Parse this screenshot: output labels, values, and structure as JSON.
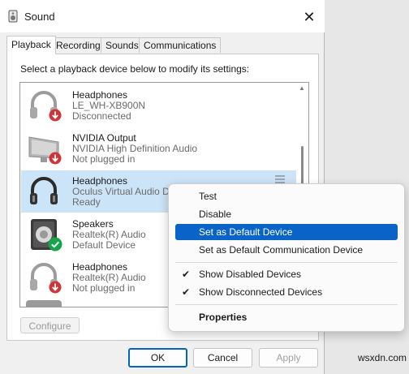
{
  "window": {
    "title": "Sound",
    "close_icon": "close-icon"
  },
  "tabs": [
    {
      "label": "Playback",
      "active": true
    },
    {
      "label": "Recording",
      "active": false
    },
    {
      "label": "Sounds",
      "active": false
    },
    {
      "label": "Communications",
      "active": false
    }
  ],
  "instruction": "Select a playback device below to modify its settings:",
  "devices": [
    {
      "name": "Headphones",
      "description": "LE_WH-XB900N",
      "status": "Disconnected",
      "icon": "headphones-icon",
      "badge": "red-down-arrow",
      "selected": false
    },
    {
      "name": "NVIDIA Output",
      "description": "NVIDIA High Definition Audio",
      "status": "Not plugged in",
      "icon": "monitor-icon",
      "badge": "red-down-arrow",
      "selected": false
    },
    {
      "name": "Headphones",
      "description": "Oculus Virtual Audio D",
      "status": "Ready",
      "icon": "headphones-icon",
      "badge": "none",
      "selected": true
    },
    {
      "name": "Speakers",
      "description": "Realtek(R) Audio",
      "status": "Default Device",
      "icon": "speaker-icon",
      "badge": "green-check",
      "selected": false
    },
    {
      "name": "Headphones",
      "description": "Realtek(R) Audio",
      "status": "Not plugged in",
      "icon": "headphones-icon",
      "badge": "red-down-arrow",
      "selected": false
    }
  ],
  "buttons": {
    "configure": "Configure",
    "ok": "OK",
    "cancel": "Cancel",
    "apply": "Apply"
  },
  "context_menu": {
    "items": [
      {
        "label": "Test",
        "checked": false,
        "highlighted": false,
        "bold": false
      },
      {
        "label": "Disable",
        "checked": false,
        "highlighted": false,
        "bold": false
      },
      {
        "label": "Set as Default Device",
        "checked": false,
        "highlighted": true,
        "bold": false
      },
      {
        "label": "Set as Default Communication Device",
        "checked": false,
        "highlighted": false,
        "bold": false
      },
      {
        "label": "Show Disabled Devices",
        "checked": true,
        "highlighted": false,
        "bold": false
      },
      {
        "label": "Show Disconnected Devices",
        "checked": true,
        "highlighted": false,
        "bold": false
      },
      {
        "label": "Properties",
        "checked": false,
        "highlighted": false,
        "bold": true
      }
    ],
    "check_glyph": "✔"
  },
  "watermark": "wsxdn.com",
  "colors": {
    "selection": "#cce4f7",
    "menu_highlight": "#0a64c8",
    "ok_border": "#0067c0",
    "badge_red": "#d13438",
    "badge_green": "#16a34a"
  }
}
